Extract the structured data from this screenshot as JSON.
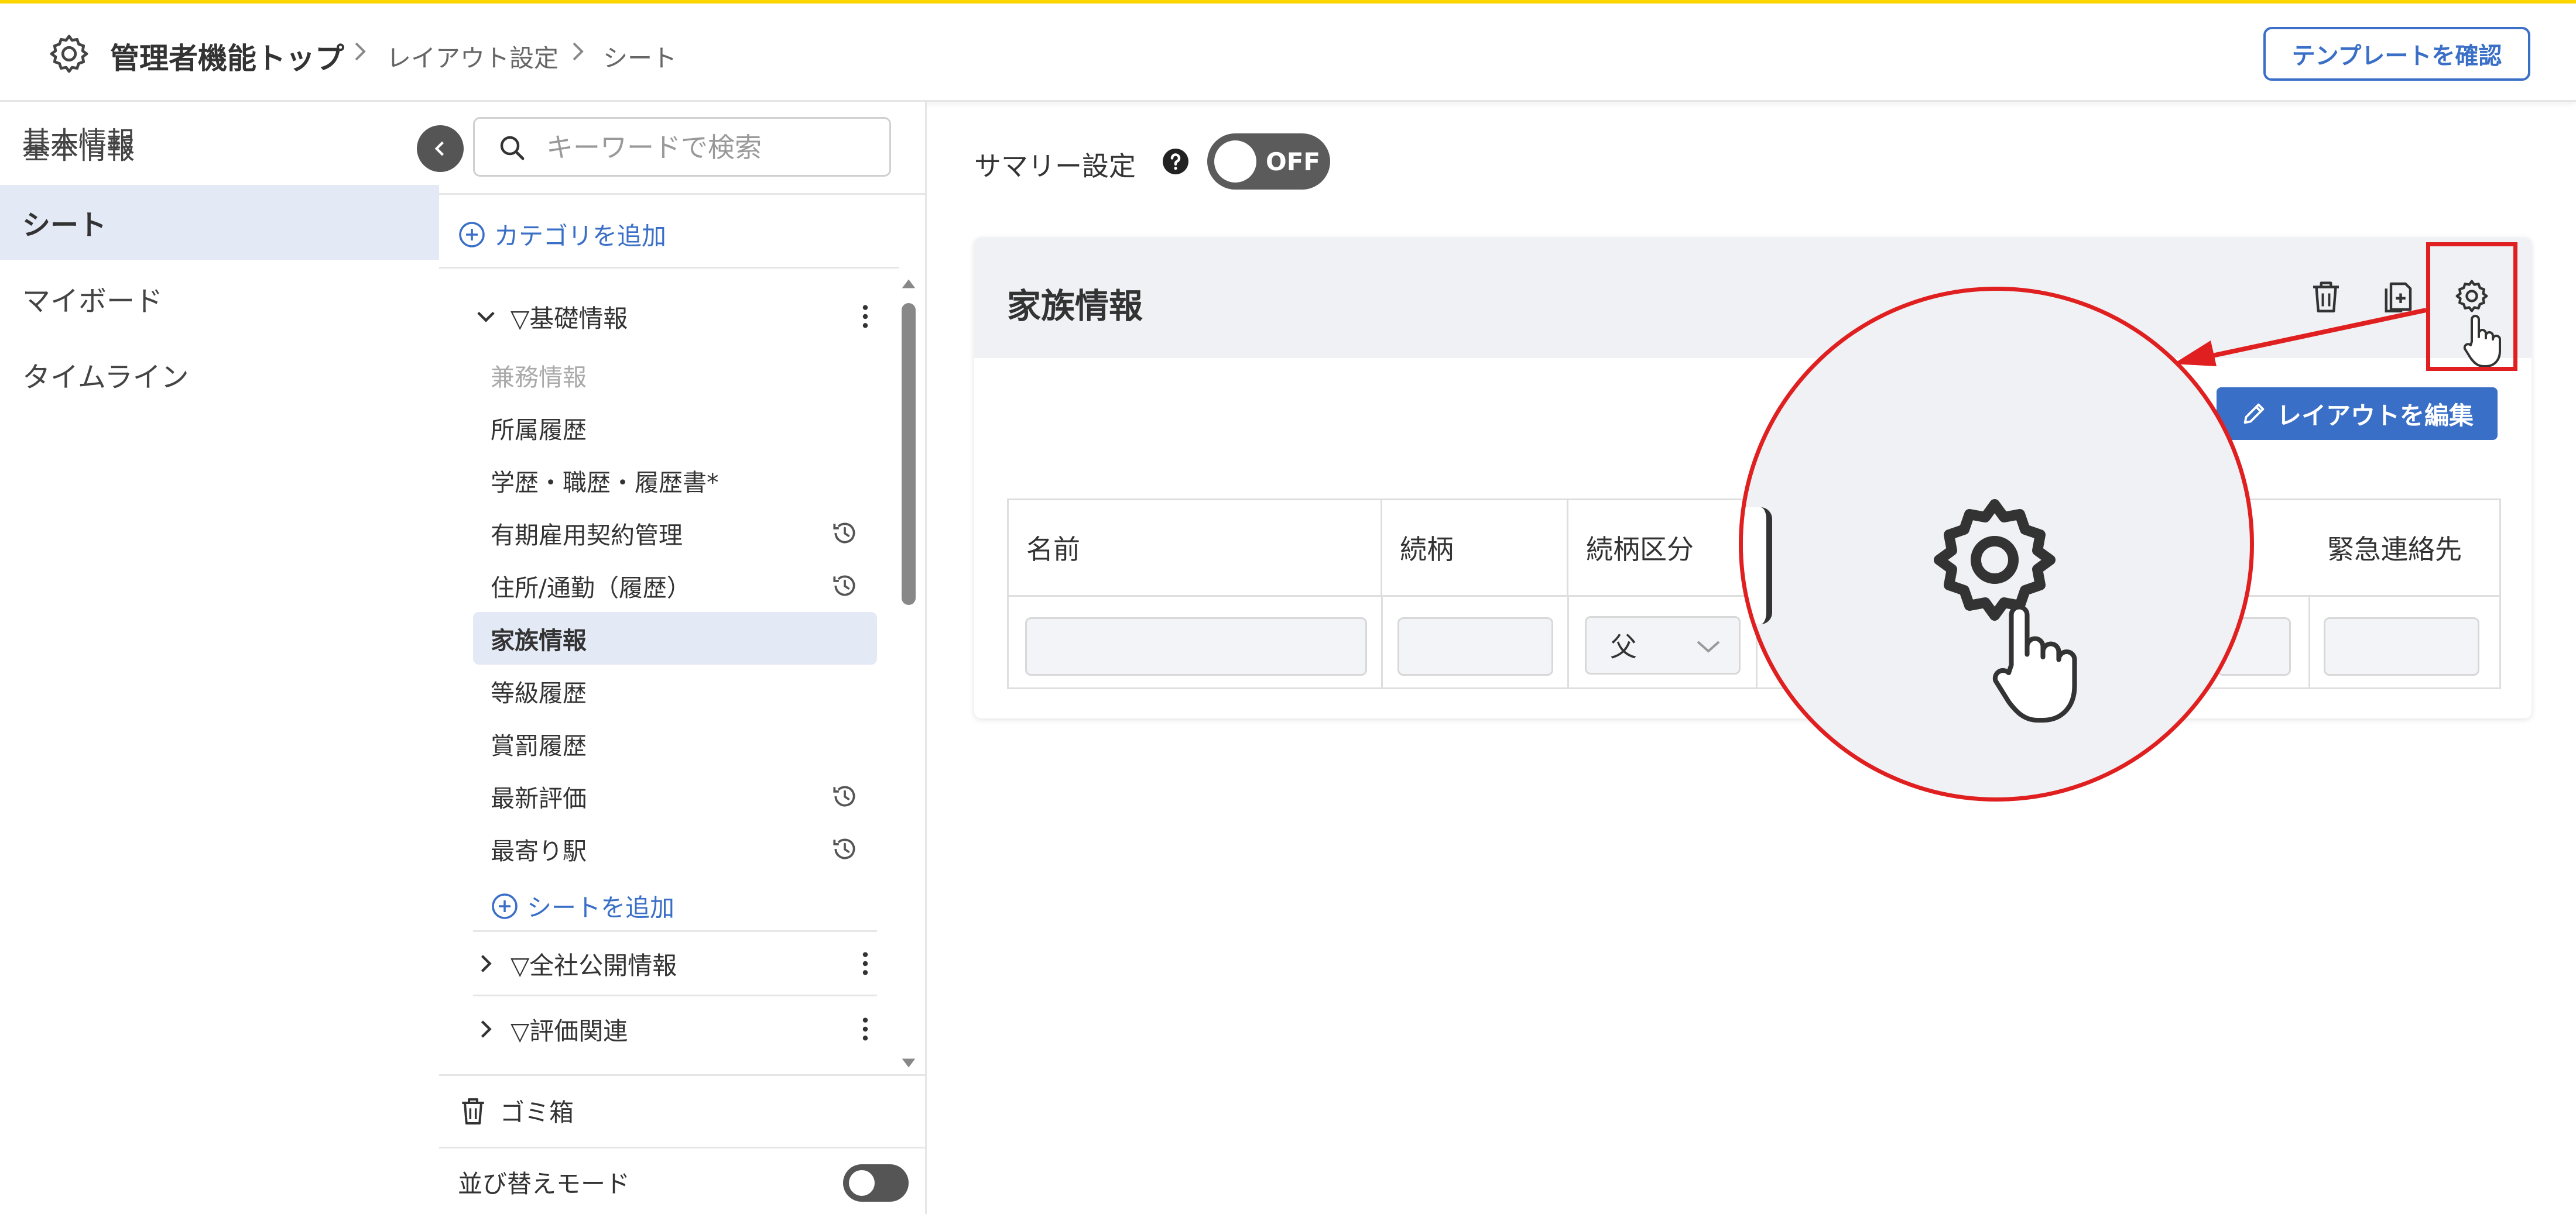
{
  "header": {
    "title": "管理者機能トップ",
    "breadcrumbs": [
      "レイアウト設定",
      "シート"
    ],
    "template_button": "テンプレートを確認",
    "accent_color": "#ffd600"
  },
  "leftnav": {
    "items": [
      {
        "label": "基本情報",
        "active": false
      },
      {
        "label": "シート",
        "active": true
      },
      {
        "label": "マイボード",
        "active": false
      },
      {
        "label": "タイムライン",
        "active": false
      }
    ]
  },
  "sidebar": {
    "search_placeholder": "キーワードで検索",
    "add_category": "カテゴリを追加",
    "categories": [
      {
        "label": "▽基礎情報",
        "expanded": true
      },
      {
        "label": "▽全社公開情報",
        "expanded": false
      },
      {
        "label": "▽評価関連",
        "expanded": false
      }
    ],
    "sheets": [
      {
        "label": "兼務情報",
        "muted": true,
        "history": false
      },
      {
        "label": "所属履歴",
        "history": false
      },
      {
        "label": "学歴・職歴・履歴書*",
        "history": false
      },
      {
        "label": "有期雇用契約管理",
        "history": true
      },
      {
        "label": "住所/通勤（履歴）",
        "history": true
      },
      {
        "label": "家族情報",
        "active": true,
        "history": false
      },
      {
        "label": "等級履歴",
        "history": false
      },
      {
        "label": "賞罰履歴",
        "history": false
      },
      {
        "label": "最新評価",
        "history": true
      },
      {
        "label": "最寄り駅",
        "history": true
      }
    ],
    "add_sheet": "シートを追加",
    "trash": "ゴミ箱",
    "sort_mode": "並び替えモード"
  },
  "main": {
    "summary_label": "サマリー設定",
    "summary_toggle": "OFF",
    "card": {
      "title": "家族情報",
      "edit_layout_button": "レイアウトを編集",
      "columns": [
        "名前",
        "続柄",
        "続柄区分",
        "緊急連絡先"
      ],
      "relationship_value": "父"
    }
  },
  "colors": {
    "primary": "#3a6fc7",
    "highlight": "#e02020",
    "active_bg": "#e4e9f6"
  }
}
